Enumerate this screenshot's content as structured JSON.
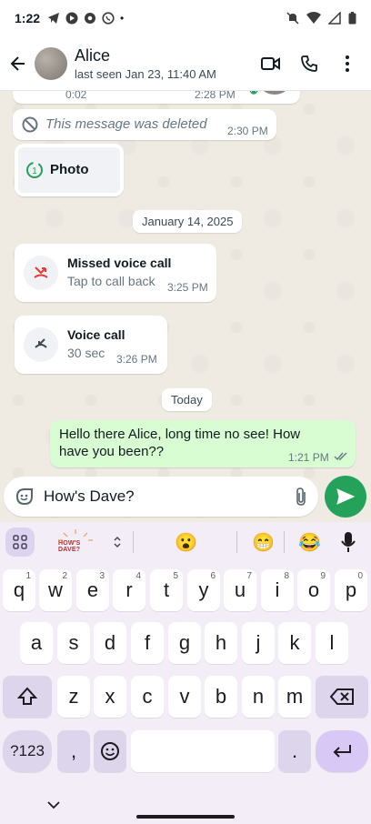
{
  "status_bar": {
    "time": "1:22",
    "dot": "•"
  },
  "header": {
    "name": "Alice",
    "last_seen": "last seen Jan 23, 11:40 AM"
  },
  "messages": {
    "voice_preview_duration": "0:02",
    "voice_preview_time": "2:28 PM",
    "deleted_text": "This message was deleted",
    "deleted_time": "2:30 PM",
    "photo_label": "Photo",
    "date_pill_1": "January 14, 2025",
    "missed_call_title": "Missed voice call",
    "missed_call_sub": "Tap to call back",
    "missed_call_time": "3:25 PM",
    "voice_call_title": "Voice call",
    "voice_call_sub": "30 sec",
    "voice_call_time": "3:26 PM",
    "date_pill_2": "Today",
    "out_text": "Hello there Alice, long time no see! How have you been??",
    "out_time": "1:21 PM"
  },
  "composer": {
    "text": "How's Dave?"
  },
  "keyboard": {
    "sticker_text": "HOW'S DAVE?",
    "emoji_1": "😮",
    "emoji_2": "😁",
    "emoji_3": "😂",
    "row1": [
      "q",
      "w",
      "e",
      "r",
      "t",
      "y",
      "u",
      "i",
      "o",
      "p"
    ],
    "row1_sup": [
      "1",
      "2",
      "3",
      "4",
      "5",
      "6",
      "7",
      "8",
      "9",
      "0"
    ],
    "row2": [
      "a",
      "s",
      "d",
      "f",
      "g",
      "h",
      "j",
      "k",
      "l"
    ],
    "row3": [
      "z",
      "x",
      "c",
      "v",
      "b",
      "n",
      "m"
    ],
    "sym_label": "?123",
    "comma": ",",
    "period": "."
  },
  "colors": {
    "accent": "#25a25a",
    "outgoing_bubble": "#d9fdd3",
    "missed_red": "#e53935"
  },
  "icons": [
    "back-arrow-icon",
    "video-call-icon",
    "phone-icon",
    "more-vert-icon",
    "blocked-icon",
    "photo-timer-icon",
    "missed-call-icon",
    "incoming-call-icon",
    "sticker-icon",
    "attach-icon",
    "send-icon",
    "grid-icon",
    "mic-icon",
    "shift-icon",
    "backspace-icon",
    "emoji-icon",
    "enter-icon",
    "chevron-down-icon"
  ]
}
